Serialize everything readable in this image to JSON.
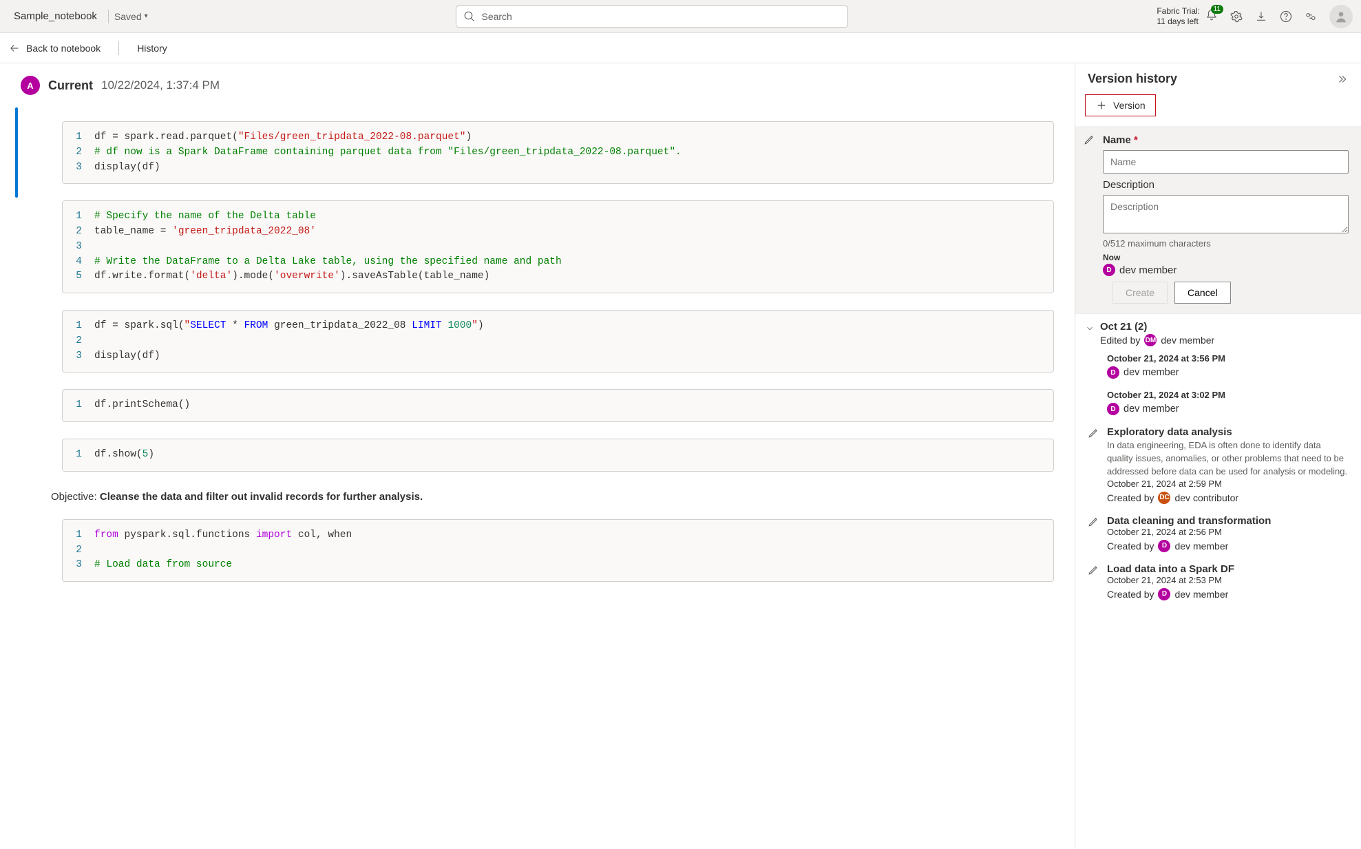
{
  "header": {
    "doc_title": "Sample_notebook",
    "saved_label": "Saved",
    "search_placeholder": "Search",
    "trial_line1": "Fabric Trial:",
    "trial_line2": "11 days left",
    "notification_count": "11"
  },
  "secondbar": {
    "back_label": "Back to notebook",
    "history_label": "History"
  },
  "current": {
    "avatar_initial": "A",
    "title": "Current",
    "timestamp": "10/22/2024, 1:37:4 PM"
  },
  "cells": [],
  "md": {
    "prefix": "Objective: ",
    "bold": "Cleanse the data and filter out invalid records for further analysis."
  },
  "panel": {
    "title": "Version history",
    "add_version_label": "Version",
    "name_label": "Name",
    "name_placeholder": "Name",
    "desc_label": "Description",
    "desc_placeholder": "Description",
    "char_count": "0/512 maximum characters",
    "now_label": "Now",
    "now_member": "dev member",
    "create_label": "Create",
    "cancel_label": "Cancel"
  },
  "history": {
    "group_title": "Oct 21 (2)",
    "group_edited_by": "Edited by",
    "group_member": "dev member",
    "entries_simple": [
      {
        "time": "October 21, 2024 at 3:56 PM",
        "member": "dev member"
      },
      {
        "time": "October 21, 2024 at 3:02 PM",
        "member": "dev member"
      }
    ],
    "entries_named": [
      {
        "title": "Exploratory data analysis",
        "desc": "In data engineering, EDA is often done to identify data quality issues, anomalies, or other problems that need to be addressed before data can be used for analysis or modeling.",
        "time": "October 21, 2024 at 2:59 PM",
        "created_by": "Created by",
        "member": "dev contributor",
        "avatar_class": "orange",
        "avatar_initial": "DC"
      },
      {
        "title": "Data cleaning and transformation",
        "desc": "",
        "time": "October 21, 2024 at 2:56 PM",
        "created_by": "Created by",
        "member": "dev member",
        "avatar_class": "",
        "avatar_initial": "D"
      },
      {
        "title": "Load data into a Spark DF",
        "desc": "",
        "time": "October 21, 2024 at 2:53 PM",
        "created_by": "Created by",
        "member": "dev member",
        "avatar_class": "",
        "avatar_initial": "D"
      }
    ]
  }
}
